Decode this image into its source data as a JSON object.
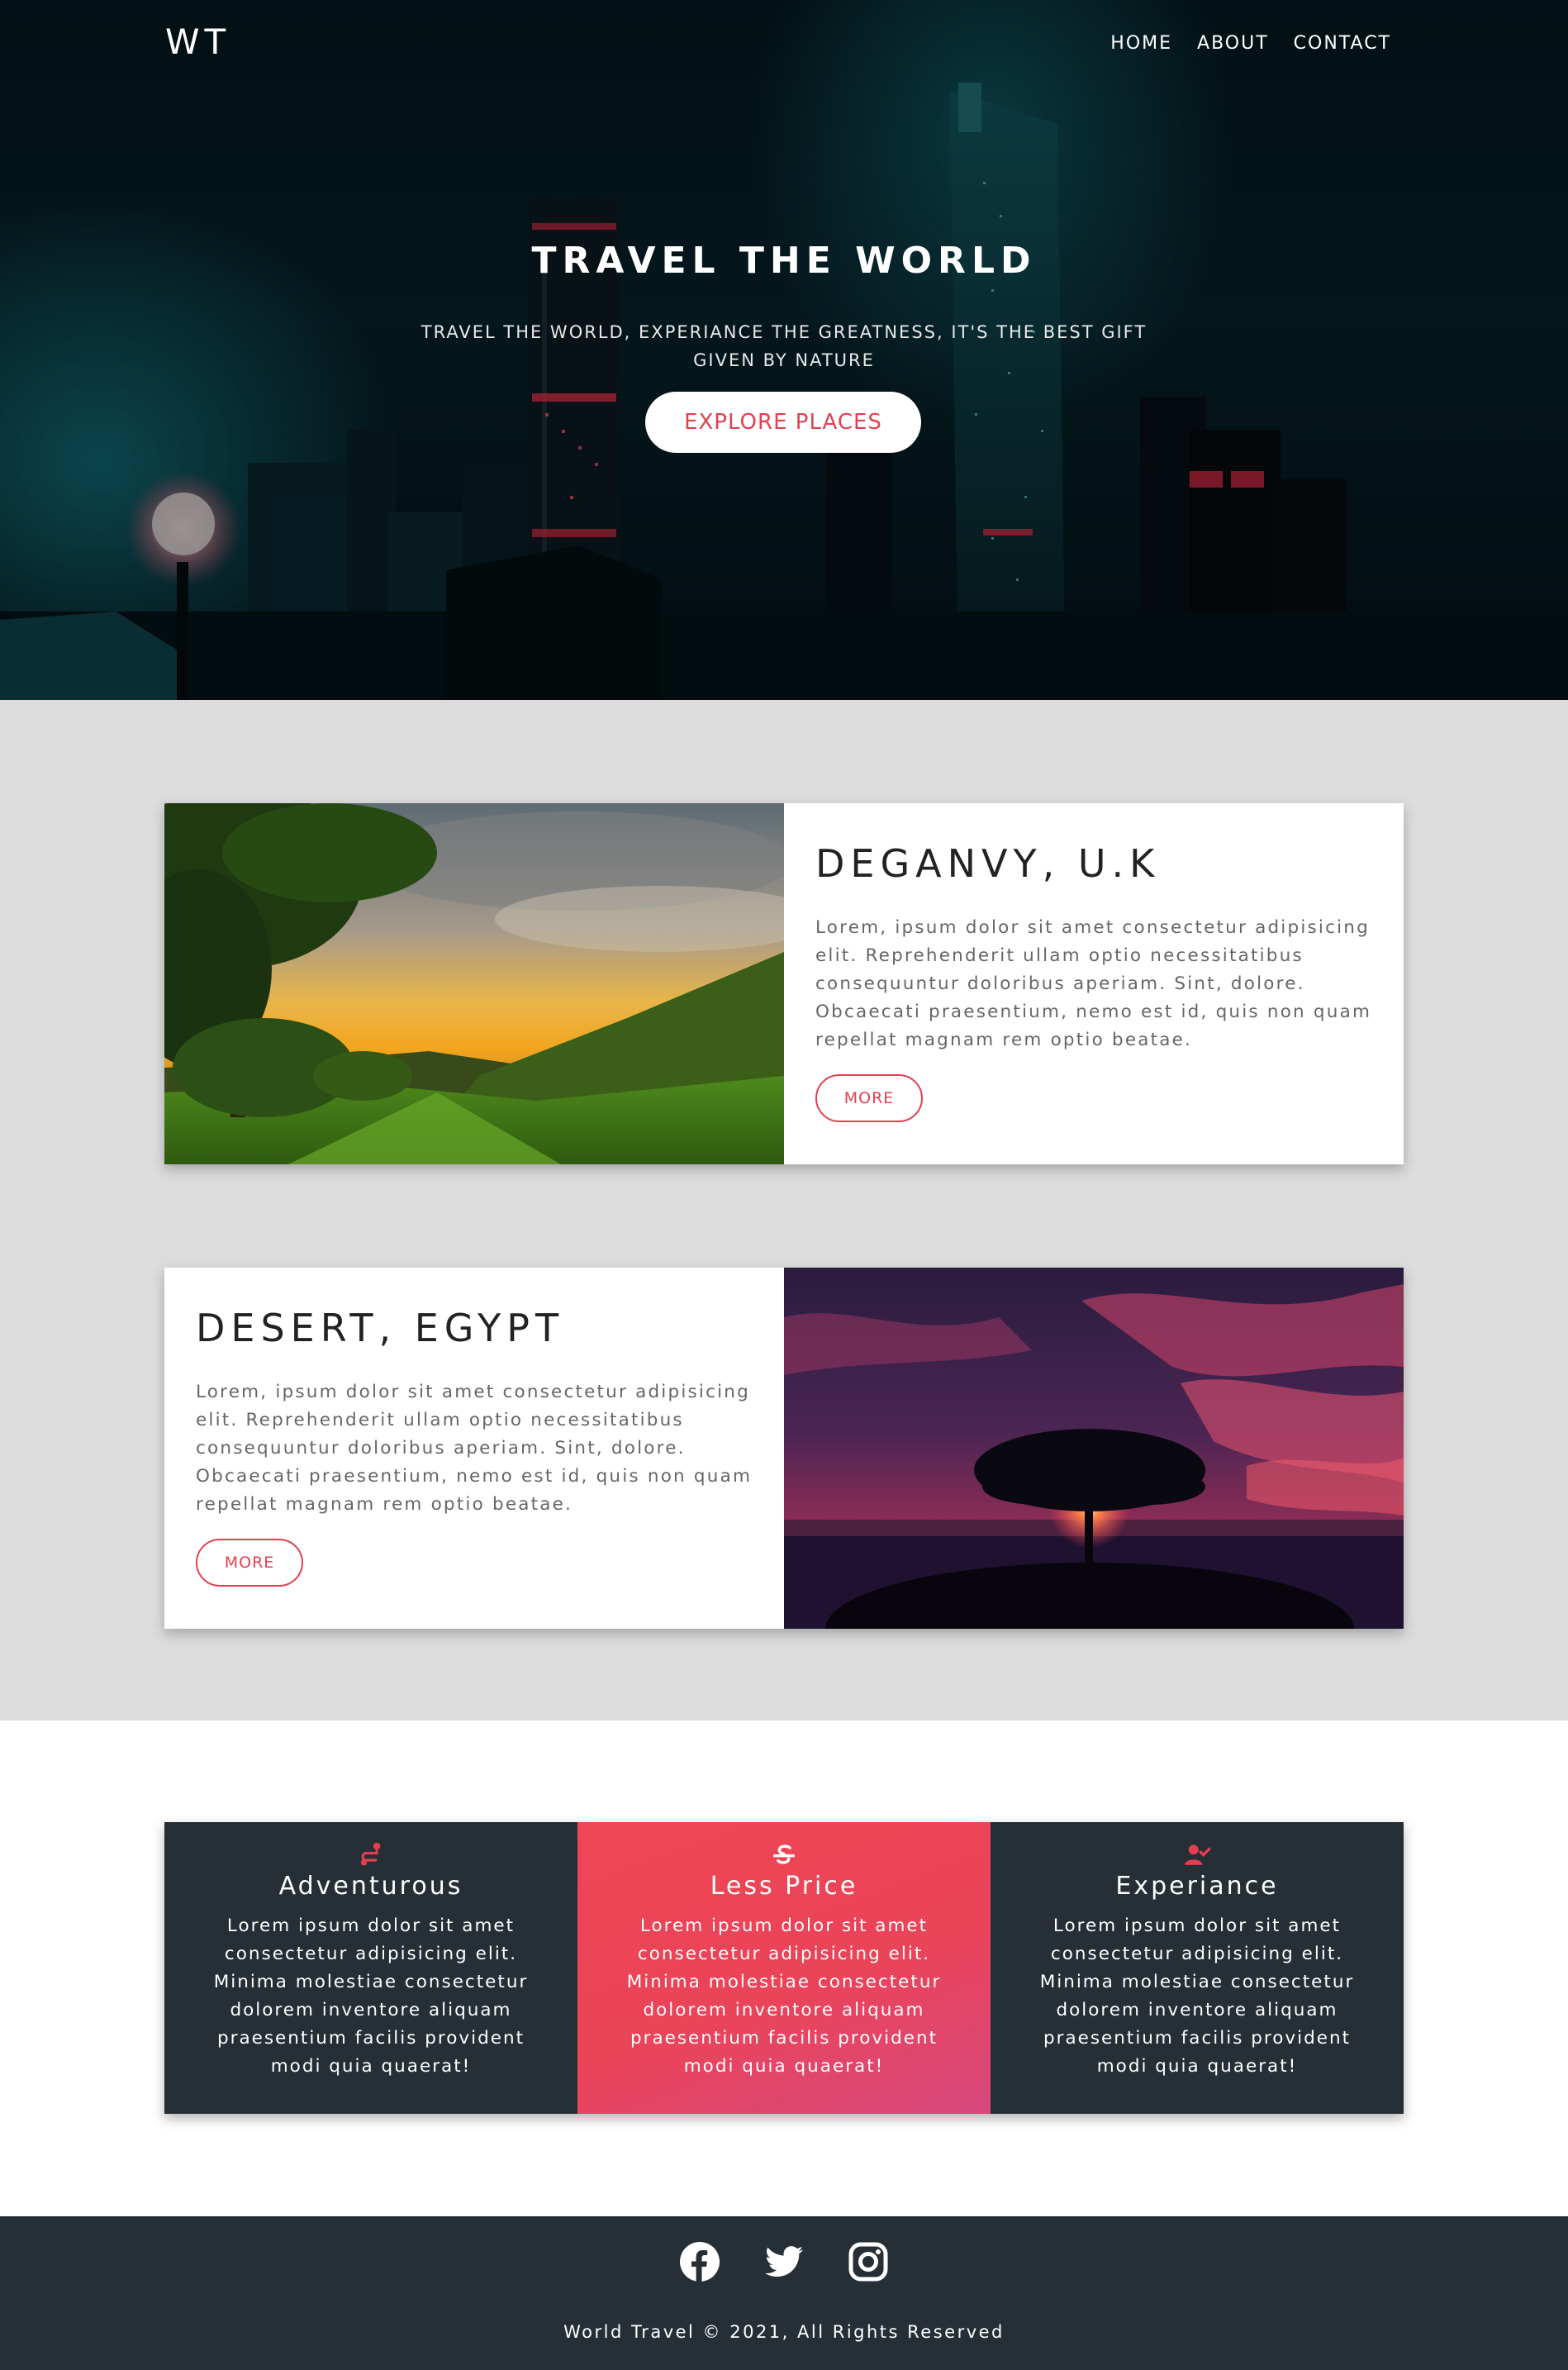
{
  "nav": {
    "logo": "WT",
    "links": [
      "HOME",
      "ABOUT",
      "CONTACT"
    ]
  },
  "hero": {
    "title": "TRAVEL THE WORLD",
    "subtitle": "TRAVEL THE WORLD, EXPERIANCE THE GREATNESS, IT'S THE BEST GIFT GIVEN BY NATURE",
    "cta_label": "EXPLORE PLACES"
  },
  "destinations": [
    {
      "title": "DEGANVY, U.K",
      "text": "Lorem, ipsum dolor sit amet consectetur adipisicing elit. Reprehenderit ullam optio necessitatibus consequuntur doloribus aperiam. Sint, dolore. Obcaecati praesentium, nemo est id, quis non quam repellat magnam rem optio beatae.",
      "button_label": "MORE"
    },
    {
      "title": "DESERT, EGYPT",
      "text": "Lorem, ipsum dolor sit amet consectetur adipisicing elit. Reprehenderit ullam optio necessitatibus consequuntur doloribus aperiam. Sint, dolore. Obcaecati praesentium, nemo est id, quis non quam repellat magnam rem optio beatae.",
      "button_label": "MORE"
    }
  ],
  "features": [
    {
      "icon": "route-icon",
      "title": "Adventurous",
      "text": "Lorem ipsum dolor sit amet consectetur adipisicing elit. Minima molestiae consectetur dolorem inventore aliquam praesentium facilis provident modi quia quaerat!"
    },
    {
      "icon": "strikethrough-s-icon",
      "title": "Less Price",
      "text": "Lorem ipsum dolor sit amet consectetur adipisicing elit. Minima molestiae consectetur dolorem inventore aliquam praesentium facilis provident modi quia quaerat!"
    },
    {
      "icon": "user-check-icon",
      "title": "Experiance",
      "text": "Lorem ipsum dolor sit amet consectetur adipisicing elit. Minima molestiae consectetur dolorem inventore aliquam praesentium facilis provident modi quia quaerat!"
    }
  ],
  "footer": {
    "socials": [
      "facebook-icon",
      "twitter-icon",
      "instagram-icon"
    ],
    "copyright": "World Travel © 2021, All Rights Reserved"
  },
  "colors": {
    "accent": "#e2404f",
    "dark": "#262f36",
    "section_gray": "#dcdcdc"
  }
}
